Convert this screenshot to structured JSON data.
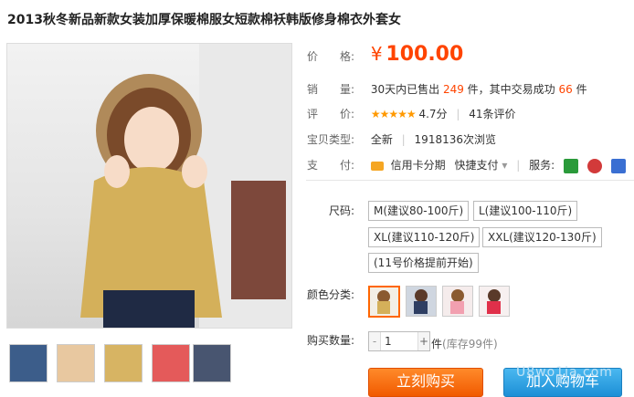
{
  "title": "2013秋冬新品新款女装加厚保暖棉服女短款棉袄韩版修身棉衣外套女",
  "price": {
    "label": "价　　格:",
    "symbol": "¥",
    "value": "100.00"
  },
  "sales": {
    "label": "销　　量:",
    "text_a": "30天内已售出",
    "sold": "249",
    "text_b": "件，其中交易成功",
    "success": "66",
    "text_c": "件"
  },
  "rating": {
    "label": "评　　价:",
    "stars": "★★★★★",
    "score": "4.7分",
    "sep": "|",
    "reviews": "41条评价"
  },
  "item_type": {
    "label": "宝贝类型:",
    "condition": "全新",
    "sep": "|",
    "views": "1918136次浏览"
  },
  "payment": {
    "label": "支　　付:",
    "card": "信用卡分期",
    "quick": "快捷支付",
    "quick_arrow": "▾",
    "sep": "|",
    "service_label": "服务:"
  },
  "options": {
    "size_label": "尺码:",
    "sizes": [
      "M(建议80-100斤)",
      "L(建议100-110斤)",
      "XL(建议110-120斤)",
      "XXL(建议120-130斤)",
      "(11号价格提前开始)"
    ],
    "color_label": "颜色分类:",
    "colors_count": 4,
    "qty_label": "购买数量:",
    "qty_minus": "-",
    "qty_value": "1",
    "qty_plus": "+",
    "qty_unit": "件",
    "stock": "(库存99件)"
  },
  "buttons": {
    "buy": "立刻购买",
    "cart": "加入购物车"
  },
  "watermark": "U8wo1ja.com",
  "colors": {
    "accent": "#ff4400",
    "buy": "#f15a00",
    "cart": "#1d8fd6"
  }
}
